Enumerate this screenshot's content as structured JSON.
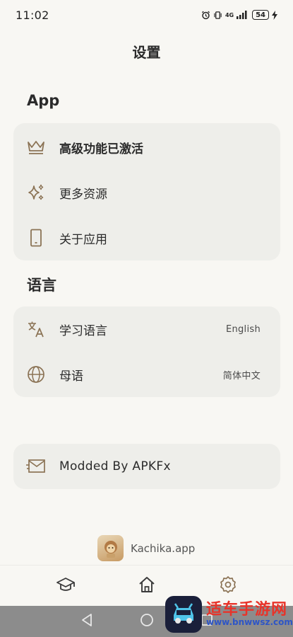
{
  "status_bar": {
    "time": "11:02",
    "network": "4G",
    "battery": "54"
  },
  "page": {
    "title": "设置"
  },
  "sections": {
    "app": {
      "title": "App",
      "items": [
        {
          "label": "高级功能已激活",
          "icon": "crown-icon"
        },
        {
          "label": "更多资源",
          "icon": "sparkles-icon"
        },
        {
          "label": "关于应用",
          "icon": "phone-icon"
        }
      ]
    },
    "language": {
      "title": "语言",
      "items": [
        {
          "label": "学习语言",
          "value": "English",
          "icon": "translate-icon"
        },
        {
          "label": "母语",
          "value": "简体中文",
          "icon": "globe-icon"
        }
      ]
    },
    "modded": {
      "items": [
        {
          "label": "Modded By APKFx",
          "icon": "mail-icon"
        }
      ]
    }
  },
  "brand": {
    "name": "Kachika.app"
  },
  "bottom_nav": [
    {
      "icon": "graduation-cap-icon"
    },
    {
      "icon": "home-icon"
    },
    {
      "icon": "gear-icon"
    }
  ],
  "watermark": {
    "text": "适车手游网",
    "url": "www.bnwwsz.com"
  },
  "colors": {
    "background": "#f8f7f3",
    "card": "#eeeeea",
    "icon_accent": "#8b7355",
    "system_nav": "#8c8c8c"
  }
}
